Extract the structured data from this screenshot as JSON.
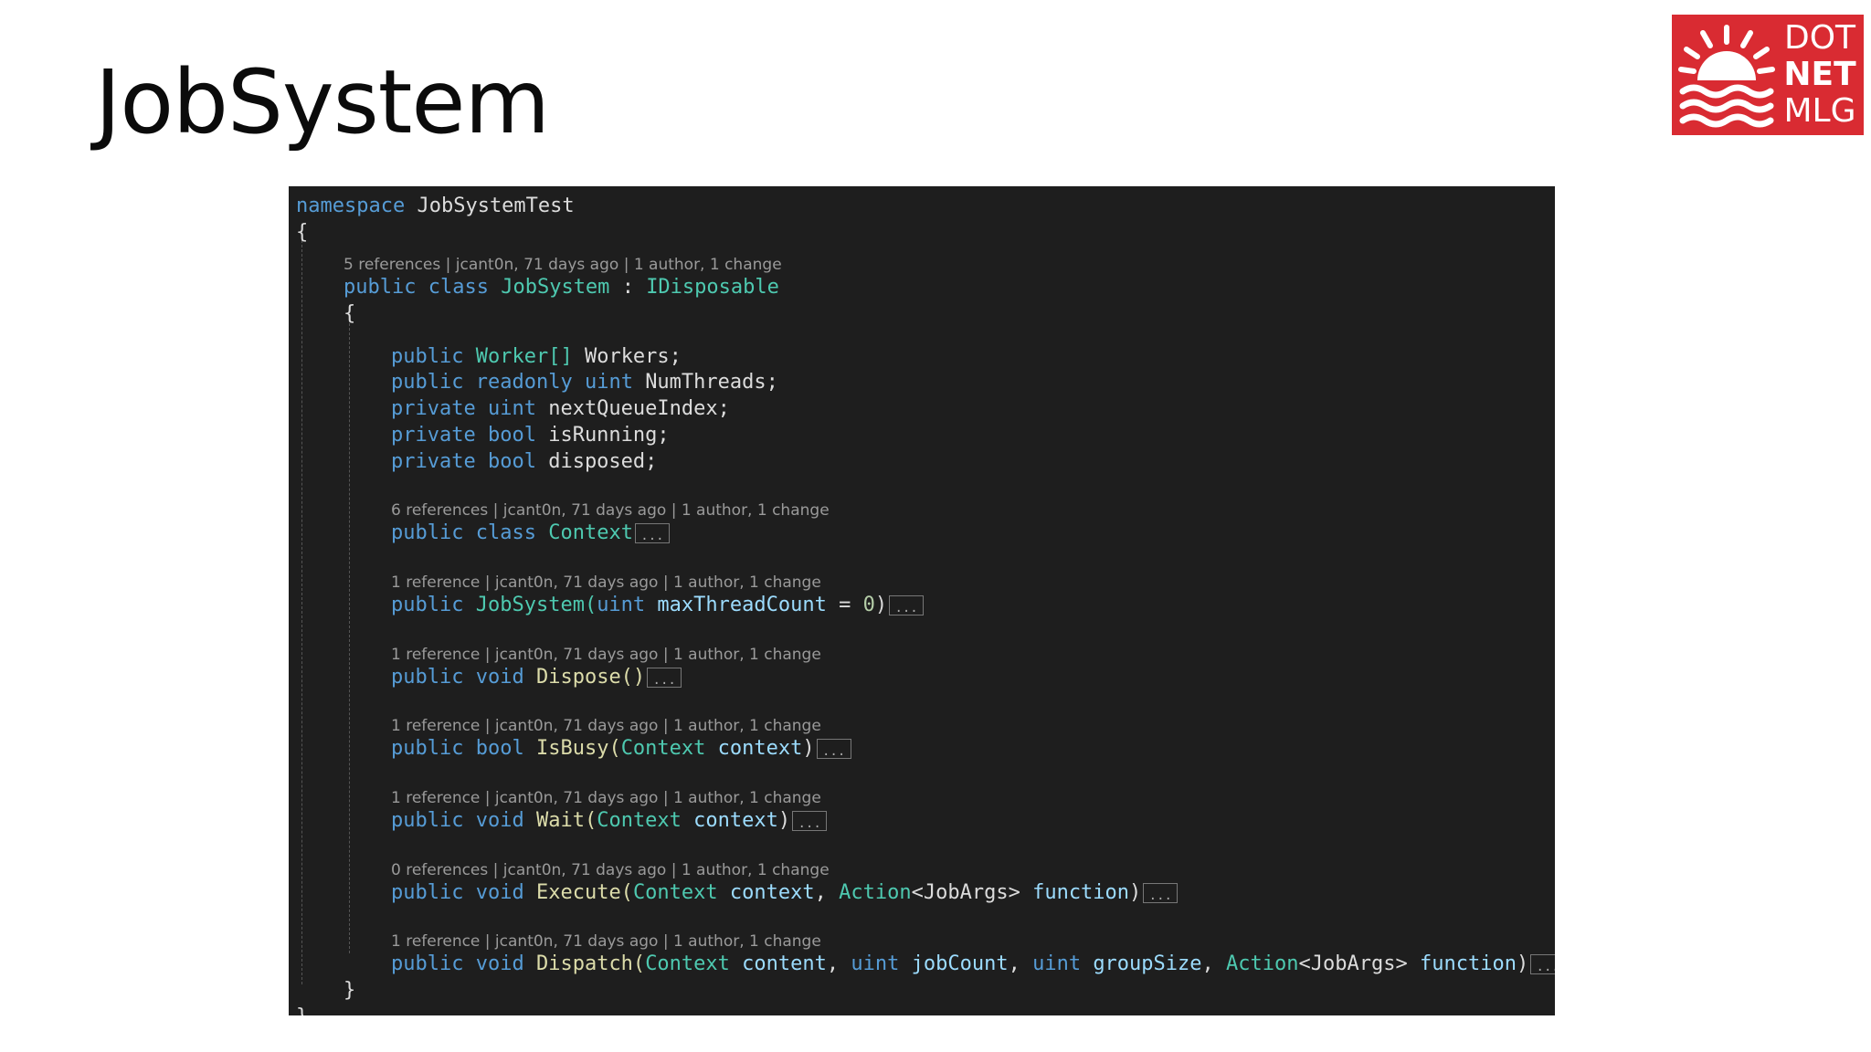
{
  "slide": {
    "title": "JobSystem"
  },
  "logo": {
    "line1": "DOT",
    "line2": "NET",
    "line3": "MLG",
    "color": "#d92b32"
  },
  "code": {
    "namespace_kw": "namespace",
    "namespace_name": "JobSystemTest",
    "open_brace": "{",
    "close_brace": "}",
    "class_lens": "5 references | jcant0n, 71 days ago | 1 author, 1 change",
    "class_decl": {
      "k1": "public",
      "k2": "class",
      "name": "JobSystem",
      "sep": ":",
      "base": "IDisposable"
    },
    "fields": [
      {
        "mod": "public",
        "mod2": "",
        "type": "Worker[]",
        "name": "Workers;"
      },
      {
        "mod": "public",
        "mod2": "readonly",
        "type": "uint",
        "name": "NumThreads;"
      },
      {
        "mod": "private",
        "mod2": "",
        "type": "uint",
        "name": "nextQueueIndex;"
      },
      {
        "mod": "private",
        "mod2": "",
        "type": "bool",
        "name": "isRunning;"
      },
      {
        "mod": "private",
        "mod2": "",
        "type": "bool",
        "name": "disposed;"
      }
    ],
    "context_lens": "6 references | jcant0n, 71 days ago | 1 author, 1 change",
    "context_decl": {
      "k1": "public",
      "k2": "class",
      "name": "Context"
    },
    "ctor_lens": "1 reference | jcant0n, 71 days ago | 1 author, 1 change",
    "ctor": {
      "k1": "public",
      "name": "JobSystem(",
      "ptype": "uint",
      "pname": "maxThreadCount",
      "eq": " = ",
      "val": "0",
      "close": ")"
    },
    "dispose_lens": "1 reference | jcant0n, 71 days ago | 1 author, 1 change",
    "dispose": {
      "k1": "public",
      "k2": "void",
      "name": "Dispose()"
    },
    "isbusy_lens": "1 reference | jcant0n, 71 days ago | 1 author, 1 change",
    "isbusy": {
      "k1": "public",
      "k2": "bool",
      "name": "IsBusy(",
      "ptype": "Context",
      "pname": "context",
      "close": ")"
    },
    "wait_lens": "1 reference | jcant0n, 71 days ago | 1 author, 1 change",
    "wait": {
      "k1": "public",
      "k2": "void",
      "name": "Wait(",
      "ptype": "Context",
      "pname": "context",
      "close": ")"
    },
    "execute_lens": "0 references | jcant0n, 71 days ago | 1 author, 1 change",
    "execute": {
      "k1": "public",
      "k2": "void",
      "name": "Execute(",
      "p1type": "Context",
      "p1name": "context",
      "comma": ", ",
      "p2type": "Action",
      "p2gen": "<JobArgs>",
      "p2name": "function",
      "close": ")"
    },
    "dispatch_lens": "1 reference | jcant0n, 71 days ago | 1 author, 1 change",
    "dispatch": {
      "k1": "public",
      "k2": "void",
      "name": "Dispatch(",
      "p1type": "Context",
      "p1name": "content",
      "comma": ", ",
      "p2type": "uint",
      "p2name": "jobCount",
      "p3type": "uint",
      "p3name": "groupSize",
      "p4type": "Action",
      "p4gen": "<JobArgs>",
      "p4name": "function",
      "close": ")"
    },
    "fold_marker": "..."
  }
}
